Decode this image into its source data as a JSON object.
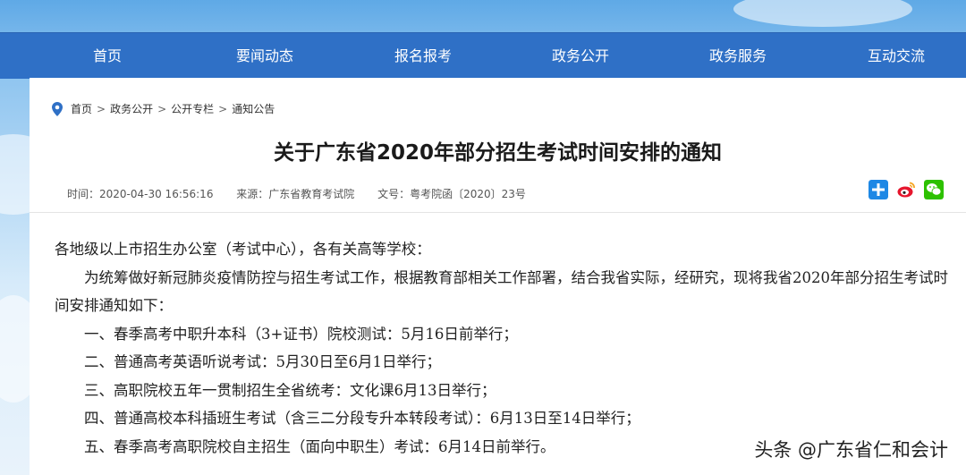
{
  "nav": {
    "items": [
      {
        "label": "首页"
      },
      {
        "label": "要闻动态"
      },
      {
        "label": "报名报考"
      },
      {
        "label": "政务公开"
      },
      {
        "label": "政务服务"
      },
      {
        "label": "互动交流"
      }
    ]
  },
  "breadcrumb": {
    "items": [
      "首页",
      "政务公开",
      "公开专栏",
      "通知公告"
    ],
    "separator": ">"
  },
  "article": {
    "title": "关于广东省2020年部分招生考试时间安排的通知",
    "time": "时间：2020-04-30 16:56:16",
    "source": "来源：广东省教育考试院",
    "doc_no": "文号：粤考院函〔2020〕23号",
    "paragraphs": [
      "各地级以上市招生办公室（考试中心），各有关高等学校：",
      "为统筹做好新冠肺炎疫情防控与招生考试工作，根据教育部相关工作部署，结合我省实际，经研究，现将我省2020年部分招生考试时间安排通知如下：",
      "一、春季高考中职升本科（3+证书）院校测试：5月16日前举行；",
      "二、普通高考英语听说考试：5月30日至6月1日举行；",
      "三、高职院校五年一贯制招生全省统考：文化课6月13日举行；",
      "四、普通高校本科插班生考试（含三二分段专升本转段考试）：6月13日至14日举行；",
      "五、春季高考高职院校自主招生（面向中职生）考试：6月14日前举行。"
    ]
  },
  "share": {
    "icons": [
      "share-plus-icon",
      "weibo-icon",
      "wechat-icon"
    ],
    "colors": {
      "plus": "#1e88e5",
      "weibo": "#e6162d",
      "wechat": "#2dc100"
    }
  },
  "watermark": "头条 @广东省仁和会计",
  "colors": {
    "nav_bg": "#2f70c6",
    "nav_text": "#ffffff"
  }
}
